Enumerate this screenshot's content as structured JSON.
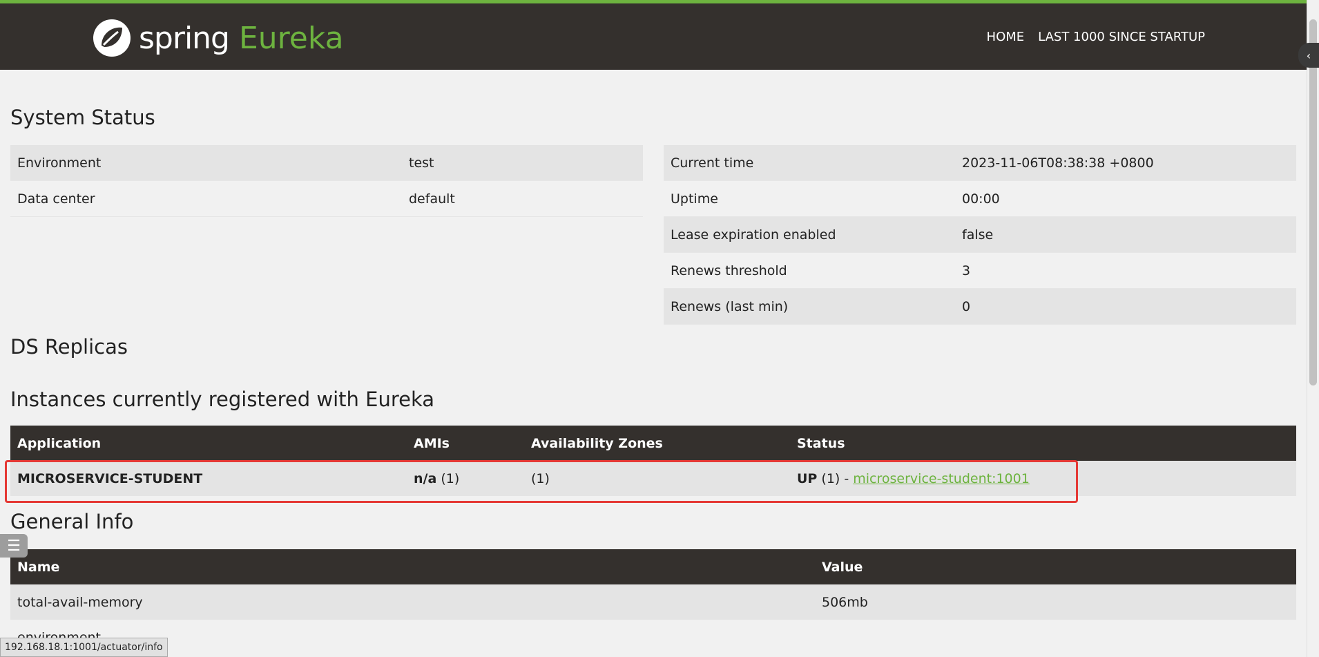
{
  "header": {
    "logo_word": "spring",
    "logo_product": "Eureka",
    "nav": [
      "HOME",
      "LAST 1000 SINCE STARTUP"
    ]
  },
  "system_status": {
    "title": "System Status",
    "left": [
      {
        "key": "Environment",
        "value": "test"
      },
      {
        "key": "Data center",
        "value": "default"
      }
    ],
    "right": [
      {
        "key": "Current time",
        "value": "2023-11-06T08:38:38 +0800"
      },
      {
        "key": "Uptime",
        "value": "00:00"
      },
      {
        "key": "Lease expiration enabled",
        "value": "false"
      },
      {
        "key": "Renews threshold",
        "value": "3"
      },
      {
        "key": "Renews (last min)",
        "value": "0"
      }
    ]
  },
  "ds_replicas": {
    "title": "DS Replicas"
  },
  "instances": {
    "title": "Instances currently registered with Eureka",
    "headers": [
      "Application",
      "AMIs",
      "Availability Zones",
      "Status"
    ],
    "row": {
      "application": "MICROSERVICE-STUDENT",
      "ami_bold": "n/a",
      "ami_count": "(1)",
      "zones": "(1)",
      "status_bold": "UP",
      "status_count": "(1) -",
      "status_link": "microservice-student:1001"
    }
  },
  "general_info": {
    "title": "General Info",
    "headers": [
      "Name",
      "Value"
    ],
    "rows": [
      {
        "name": "total-avail-memory",
        "value": "506mb"
      },
      {
        "name": "environment",
        "value": ""
      }
    ]
  },
  "statusbar": {
    "url": "192.168.18.1:1001/actuator/info"
  },
  "colors": {
    "brand_green": "#6db33f",
    "navbar": "#34302d",
    "highlight": "#e53935"
  }
}
